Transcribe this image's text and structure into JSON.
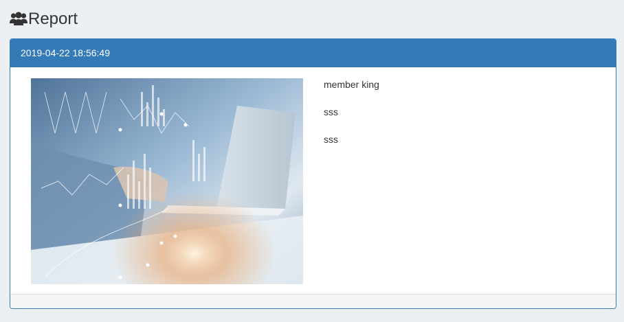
{
  "header": {
    "title": "Report",
    "icon": "users-icon"
  },
  "report": {
    "timestamp": "2019-04-22 18:56:49",
    "image": "business-analytics-laptop-photo",
    "lines": [
      "member king",
      "sss",
      "sss"
    ]
  },
  "colors": {
    "accent": "#337ab7",
    "background": "#ecf0f5"
  }
}
